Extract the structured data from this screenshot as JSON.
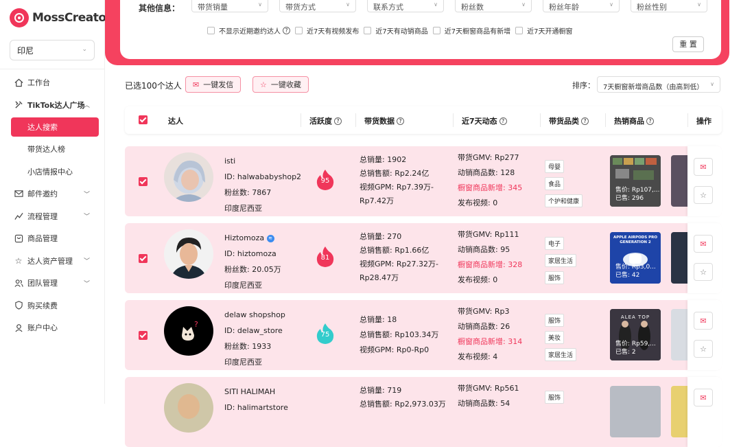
{
  "brand": {
    "name": "MossCreator",
    "accent": "#f0365a"
  },
  "region": {
    "value": "印尼"
  },
  "nav": [
    {
      "icon": "home-icon",
      "label": "工作台"
    },
    {
      "icon": "tools-icon",
      "label": "TikTok达人广场",
      "expanded": true
    },
    {
      "label": "达人搜索",
      "active": true
    },
    {
      "label": "带货达人榜"
    },
    {
      "label": "小店情报中心"
    },
    {
      "icon": "mail-icon",
      "label": "邮件邀约",
      "has_arrow": true
    },
    {
      "icon": "flow-icon",
      "label": "流程管理",
      "has_arrow": true
    },
    {
      "icon": "box-icon",
      "label": "商品管理"
    },
    {
      "icon": "star-icon",
      "label": "达人资产管理",
      "has_arrow": true
    },
    {
      "icon": "team-icon",
      "label": "团队管理",
      "has_arrow": true
    },
    {
      "icon": "shield-icon",
      "label": "购买续费"
    },
    {
      "icon": "user-icon",
      "label": "账户中心"
    }
  ],
  "filters": {
    "other_label": "其他信息：",
    "selects": [
      "带货销量",
      "带货方式",
      "联系方式",
      "粉丝数",
      "粉丝年龄",
      "粉丝性别"
    ],
    "checkboxes": [
      "不显示近期邀约达人",
      "近7天有视频发布",
      "近7天有动销商品",
      "近7天橱窗商品有新增",
      "近7天开通橱窗"
    ],
    "reset": "重 置"
  },
  "toolbar": {
    "selected": "已选100个达人",
    "send": "一键发信",
    "collect": "一键收藏",
    "sort_label": "排序：",
    "sort_value": "7天橱窗新增商品数（由高到低）"
  },
  "table_headers": {
    "creator": "达人",
    "activity": "活跃度",
    "sales": "带货数据",
    "recent": "近7天动态",
    "category": "带货品类",
    "hot": "热销商品",
    "ops": "操作"
  },
  "rows": [
    {
      "name": "isti",
      "id": "ID: halwababyshop2",
      "fans": "粉丝数: 7867",
      "country": "印度尼西亚",
      "activity": "95",
      "activity_color": "#f0365a",
      "sales": [
        "总销量:  1902",
        "总销售额:  Rp2.24亿",
        "视频GPM:  Rp7.39万-Rp7.42万"
      ],
      "recent": [
        "带货GMV:  Rp277",
        "动销商品数:  128",
        "橱窗商品新增:  345",
        "发布视频:  0"
      ],
      "tags": [
        "母婴",
        "食品",
        "个护和健康"
      ],
      "product": {
        "price": "售价: Rp107,...",
        "sold": "已售: 296"
      }
    },
    {
      "name": "Hiztomoza",
      "id": "ID: hiztomoza",
      "fans": "粉丝数: 20.05万",
      "country": "印度尼西亚",
      "activity": "81",
      "activity_color": "#f0365a",
      "sales": [
        "总销量:  270",
        "总销售额:  Rp1.66亿",
        "视频GPM:  Rp27.32万-Rp28.47万"
      ],
      "recent": [
        "带货GMV:  Rp111",
        "动销商品数:  95",
        "橱窗商品新增:  328",
        "发布视频:  0"
      ],
      "tags": [
        "电子",
        "家居生活",
        "服饰"
      ],
      "product": {
        "price": "售价: Rp3,0...",
        "sold": "已售: 42",
        "banner": "APPLE AIRPODS PRO GENERATION 2"
      }
    },
    {
      "name": "delaw shopshop",
      "id": "ID: delaw_store",
      "fans": "粉丝数: 1933",
      "country": "印度尼西亚",
      "activity": "75",
      "activity_color": "#33cccc",
      "sales": [
        "总销量:  18",
        "总销售额:  Rp103.34万",
        "视频GPM:  Rp0-Rp0"
      ],
      "recent": [
        "带货GMV:  Rp3",
        "动销商品数:  26",
        "橱窗商品新增:  314",
        "发布视频:  4"
      ],
      "tags": [
        "服饰",
        "美妆",
        "家居生活"
      ],
      "product": {
        "price": "售价: Rp59,...",
        "sold": "已售: 2",
        "banner": "ALEA TOP"
      }
    },
    {
      "name": "SITI HALIMAH",
      "id": "ID: halimartstore",
      "fans": "",
      "country": "",
      "activity": "",
      "activity_color": "#f0365a",
      "sales": [
        "总销量:  719",
        "总销售额:  Rp2,973.03万",
        ""
      ],
      "recent": [
        "带货GMV:  Rp561",
        "动销商品数:  54",
        "",
        ""
      ],
      "tags": [
        "服饰",
        "",
        ""
      ],
      "product": {
        "price": "",
        "sold": ""
      }
    }
  ],
  "partial_product_labels": [
    "售价",
    "已售"
  ]
}
